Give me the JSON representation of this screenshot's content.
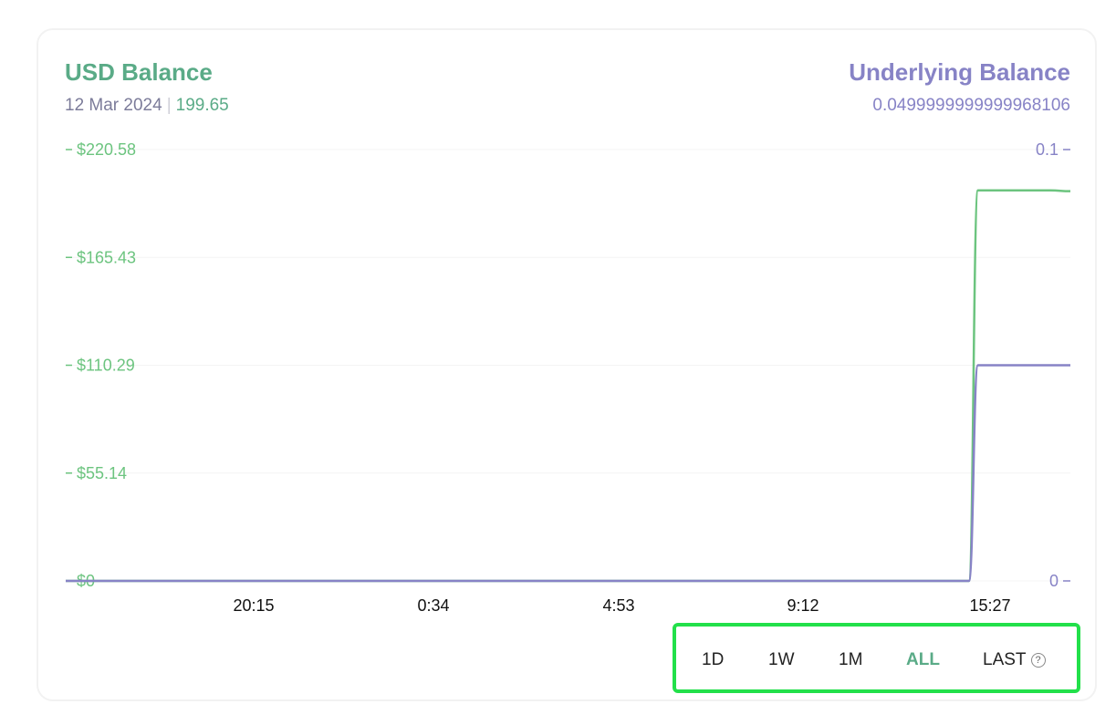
{
  "header": {
    "left_title": "USD Balance",
    "left_date": "12 Mar 2024",
    "left_separator": "|",
    "left_value": "199.65",
    "right_title": "Underlying Balance",
    "right_value": "0.0499999999999968106"
  },
  "range_selector": {
    "buttons": [
      {
        "label": "1D",
        "active": false
      },
      {
        "label": "1W",
        "active": false
      },
      {
        "label": "1M",
        "active": false
      },
      {
        "label": "ALL",
        "active": true
      },
      {
        "label": "LAST",
        "active": false,
        "icon": "help-icon"
      }
    ],
    "help_icon_glyph": "?"
  },
  "chart_data": {
    "type": "line",
    "x_tick_labels": [
      "20:15",
      "0:34",
      "4:53",
      "9:12",
      "15:27"
    ],
    "y_left": {
      "ticks": [
        0,
        55.14,
        110.29,
        165.43,
        220.58
      ],
      "tick_labels": [
        "$0",
        "$55.14",
        "$110.29",
        "$165.43",
        "$220.58"
      ],
      "range": [
        0,
        220.58
      ]
    },
    "y_right": {
      "ticks": [
        0,
        0.1
      ],
      "tick_labels": [
        "0",
        "0.1"
      ],
      "range": [
        0,
        0.1
      ]
    },
    "series": [
      {
        "axis": "left",
        "color": "#6cc47f",
        "points": [
          [
            0.0,
            0
          ],
          [
            0.899,
            0
          ],
          [
            0.908,
            199.7
          ],
          [
            0.98,
            199.7
          ],
          [
            1.0,
            199.3
          ]
        ]
      },
      {
        "axis": "right",
        "color": "#8783c6",
        "points": [
          [
            0.0,
            0
          ],
          [
            0.899,
            0
          ],
          [
            0.908,
            0.05
          ],
          [
            1.0,
            0.05
          ]
        ]
      }
    ]
  }
}
